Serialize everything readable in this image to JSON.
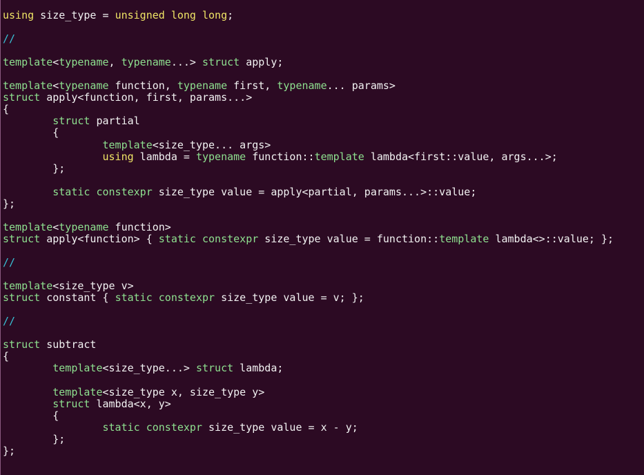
{
  "colors": {
    "background": "#2c0a23",
    "normal": "#f2f2f2",
    "keyword": "#8ee08f",
    "type": "#f0e566",
    "comment": "#38c2d6"
  },
  "lines": [
    [
      [
        "type",
        "using"
      ],
      [
        "normal",
        " size_type = "
      ],
      [
        "type",
        "unsigned long long"
      ],
      [
        "normal",
        ";"
      ]
    ],
    [],
    [
      [
        "comment",
        "//"
      ]
    ],
    [],
    [
      [
        "keyword",
        "template"
      ],
      [
        "normal",
        "<"
      ],
      [
        "keyword",
        "typename"
      ],
      [
        "normal",
        ", "
      ],
      [
        "keyword",
        "typename"
      ],
      [
        "normal",
        "...> "
      ],
      [
        "keyword",
        "struct"
      ],
      [
        "normal",
        " apply;"
      ]
    ],
    [],
    [
      [
        "keyword",
        "template"
      ],
      [
        "normal",
        "<"
      ],
      [
        "keyword",
        "typename"
      ],
      [
        "normal",
        " function, "
      ],
      [
        "keyword",
        "typename"
      ],
      [
        "normal",
        " first, "
      ],
      [
        "keyword",
        "typename"
      ],
      [
        "normal",
        "... params>"
      ]
    ],
    [
      [
        "keyword",
        "struct"
      ],
      [
        "normal",
        " apply<function, first, params...>"
      ]
    ],
    [
      [
        "normal",
        "{"
      ]
    ],
    [
      [
        "normal",
        "        "
      ],
      [
        "keyword",
        "struct"
      ],
      [
        "normal",
        " partial"
      ]
    ],
    [
      [
        "normal",
        "        {"
      ]
    ],
    [
      [
        "normal",
        "                "
      ],
      [
        "keyword",
        "template"
      ],
      [
        "normal",
        "<size_type... args>"
      ]
    ],
    [
      [
        "normal",
        "                "
      ],
      [
        "type",
        "using"
      ],
      [
        "normal",
        " lambda = "
      ],
      [
        "keyword",
        "typename"
      ],
      [
        "normal",
        " function::"
      ],
      [
        "keyword",
        "template"
      ],
      [
        "normal",
        " lambda<first::value, args...>;"
      ]
    ],
    [
      [
        "normal",
        "        };"
      ]
    ],
    [],
    [
      [
        "normal",
        "        "
      ],
      [
        "keyword",
        "static constexpr"
      ],
      [
        "normal",
        " size_type value = apply<partial, params...>::value;"
      ]
    ],
    [
      [
        "normal",
        "};"
      ]
    ],
    [],
    [
      [
        "keyword",
        "template"
      ],
      [
        "normal",
        "<"
      ],
      [
        "keyword",
        "typename"
      ],
      [
        "normal",
        " function>"
      ]
    ],
    [
      [
        "keyword",
        "struct"
      ],
      [
        "normal",
        " apply<function> { "
      ],
      [
        "keyword",
        "static constexpr"
      ],
      [
        "normal",
        " size_type value = function::"
      ],
      [
        "keyword",
        "template"
      ],
      [
        "normal",
        " lambda<>::value; };"
      ]
    ],
    [],
    [
      [
        "comment",
        "//"
      ]
    ],
    [],
    [
      [
        "keyword",
        "template"
      ],
      [
        "normal",
        "<size_type v>"
      ]
    ],
    [
      [
        "keyword",
        "struct"
      ],
      [
        "normal",
        " constant { "
      ],
      [
        "keyword",
        "static constexpr"
      ],
      [
        "normal",
        " size_type value = v; };"
      ]
    ],
    [],
    [
      [
        "comment",
        "//"
      ]
    ],
    [],
    [
      [
        "keyword",
        "struct"
      ],
      [
        "normal",
        " subtract"
      ]
    ],
    [
      [
        "normal",
        "{"
      ]
    ],
    [
      [
        "normal",
        "        "
      ],
      [
        "keyword",
        "template"
      ],
      [
        "normal",
        "<size_type...> "
      ],
      [
        "keyword",
        "struct"
      ],
      [
        "normal",
        " lambda;"
      ]
    ],
    [],
    [
      [
        "normal",
        "        "
      ],
      [
        "keyword",
        "template"
      ],
      [
        "normal",
        "<size_type x, size_type y>"
      ]
    ],
    [
      [
        "normal",
        "        "
      ],
      [
        "keyword",
        "struct"
      ],
      [
        "normal",
        " lambda<x, y>"
      ]
    ],
    [
      [
        "normal",
        "        {"
      ]
    ],
    [
      [
        "normal",
        "                "
      ],
      [
        "keyword",
        "static constexpr"
      ],
      [
        "normal",
        " size_type value = x - y;"
      ]
    ],
    [
      [
        "normal",
        "        };"
      ]
    ],
    [
      [
        "normal",
        "};"
      ]
    ]
  ]
}
